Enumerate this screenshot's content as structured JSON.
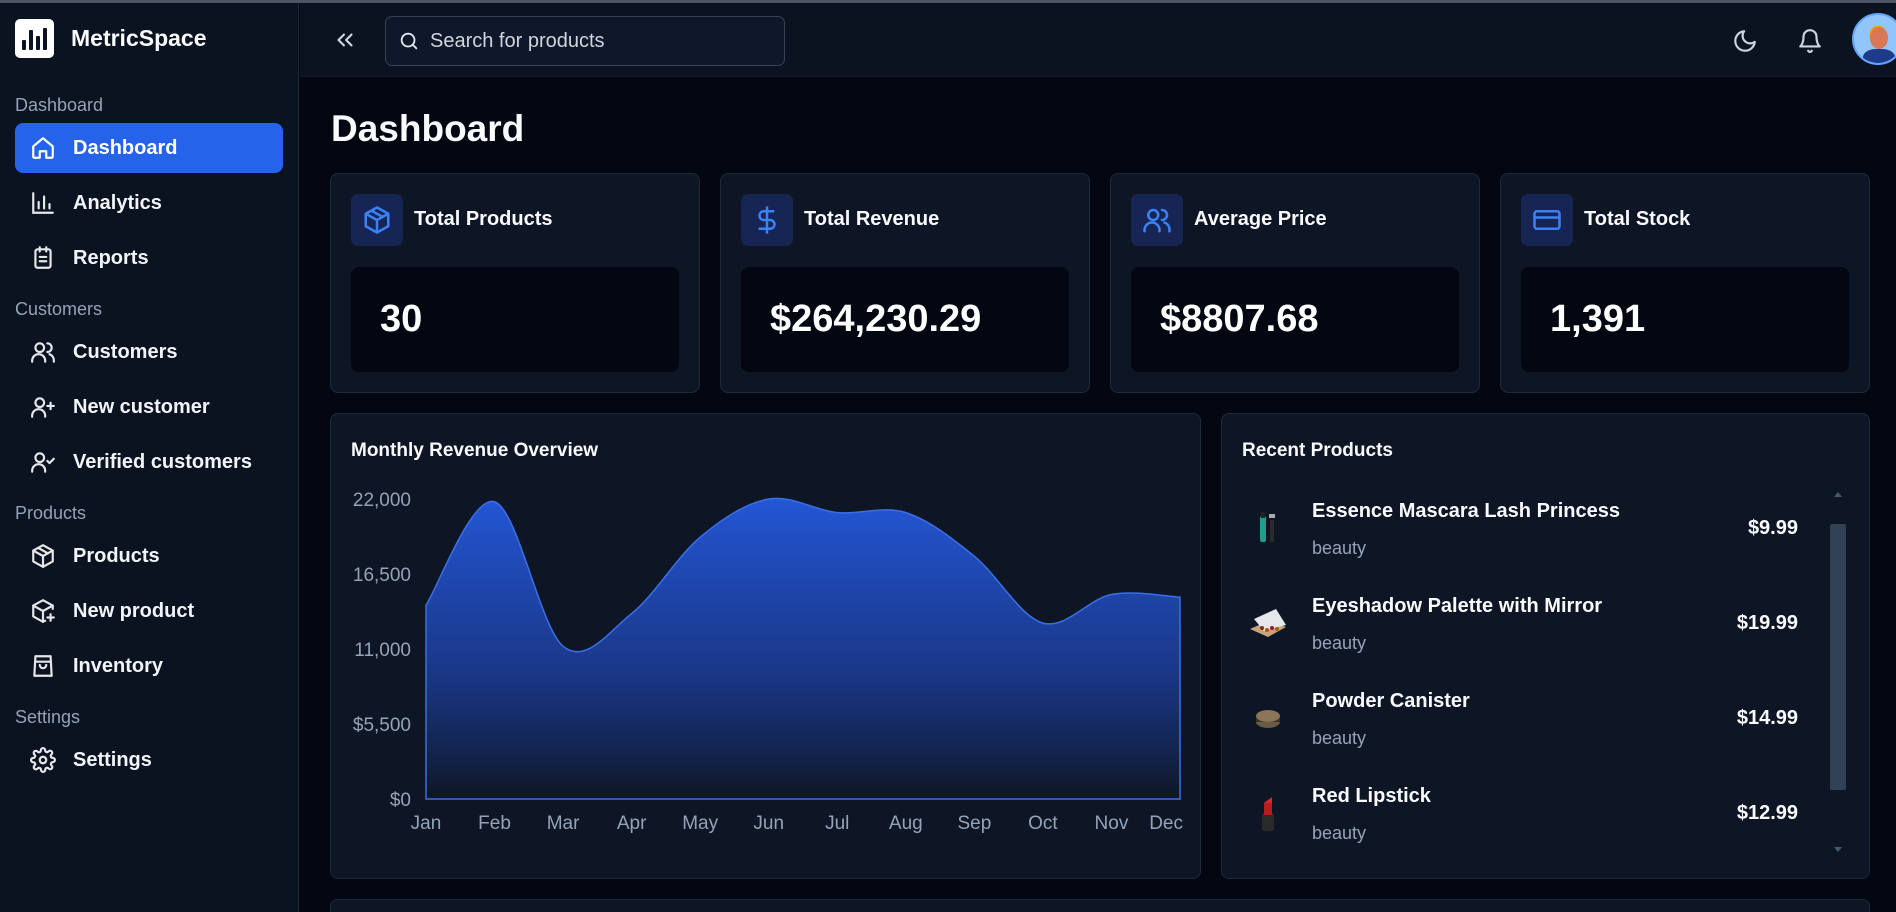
{
  "app": {
    "name": "MetricSpace"
  },
  "colors": {
    "accent": "#2563eb",
    "background": "#030712",
    "sidebar": "#0b1220",
    "card": "#0e1626",
    "icon_accent": "#3b82f6"
  },
  "sidebar": {
    "sections": [
      {
        "title": "Dashboard",
        "items": [
          {
            "label": "Dashboard",
            "icon": "home-icon",
            "active": true
          },
          {
            "label": "Analytics",
            "icon": "bar-chart-icon"
          },
          {
            "label": "Reports",
            "icon": "clipboard-icon"
          }
        ]
      },
      {
        "title": "Customers",
        "items": [
          {
            "label": "Customers",
            "icon": "users-icon"
          },
          {
            "label": "New customer",
            "icon": "user-plus-icon"
          },
          {
            "label": "Verified customers",
            "icon": "user-check-icon"
          }
        ]
      },
      {
        "title": "Products",
        "items": [
          {
            "label": "Products",
            "icon": "package-icon"
          },
          {
            "label": "New product",
            "icon": "package-plus-icon"
          },
          {
            "label": "Inventory",
            "icon": "shopping-bag-icon"
          }
        ]
      },
      {
        "title": "Settings",
        "items": [
          {
            "label": "Settings",
            "icon": "gear-icon"
          }
        ]
      }
    ]
  },
  "header": {
    "search_placeholder": "Search for products",
    "icons": [
      "collapse-icon",
      "search-icon",
      "moon-icon",
      "bell-icon",
      "avatar"
    ]
  },
  "page": {
    "title": "Dashboard"
  },
  "stats": [
    {
      "title": "Total Products",
      "value": "30",
      "icon": "box-icon"
    },
    {
      "title": "Total Revenue",
      "value": "$264,230.29",
      "icon": "dollar-icon"
    },
    {
      "title": "Average Price",
      "value": "$8807.68",
      "icon": "users-icon"
    },
    {
      "title": "Total Stock",
      "value": "1,391",
      "icon": "credit-card-icon"
    }
  ],
  "chart": {
    "title": "Monthly Revenue Overview"
  },
  "chart_data": {
    "type": "area",
    "title": "Monthly Revenue Overview",
    "categories": [
      "Jan",
      "Feb",
      "Mar",
      "Apr",
      "May",
      "Jun",
      "Jul",
      "Aug",
      "Sep",
      "Oct",
      "Nov",
      "Dec"
    ],
    "series": [
      {
        "values": [
          14200,
          21800,
          11200,
          13600,
          19200,
          22000,
          21000,
          21000,
          17800,
          12900,
          15000,
          14800
        ]
      }
    ],
    "y_ticks": [
      "$0",
      "$5,500",
      "11,000",
      "16,500",
      "22,000"
    ],
    "ylim": [
      0,
      22000
    ],
    "grid": false,
    "fill_color": "#2563eb"
  },
  "recent": {
    "title": "Recent Products",
    "items": [
      {
        "name": "Essence Mascara Lash Princess",
        "category": "beauty",
        "price": "$9.99",
        "thumb": "mascara-thumbnail"
      },
      {
        "name": "Eyeshadow Palette with Mirror",
        "category": "beauty",
        "price": "$19.99",
        "thumb": "eyeshadow-palette-thumbnail"
      },
      {
        "name": "Powder Canister",
        "category": "beauty",
        "price": "$14.99",
        "thumb": "powder-canister-thumbnail"
      },
      {
        "name": "Red Lipstick",
        "category": "beauty",
        "price": "$12.99",
        "thumb": "lipstick-thumbnail"
      }
    ]
  }
}
